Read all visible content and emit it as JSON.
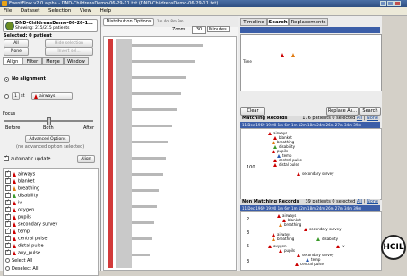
{
  "window": {
    "title": "EventFlow v2.0 alpha - DND-ChildrensDemo-06-29-11.txt (DND-ChildrensDemo-06-29-11.txt)"
  },
  "menu": [
    "File",
    "Dataset",
    "Selection",
    "View",
    "Help"
  ],
  "dataset": {
    "name": "DND-ChildrensDemo-06-26-1...",
    "showing": "Showing: 215/215 patients"
  },
  "selection": {
    "label": "Selected: 0 patient",
    "all": "All",
    "none": "None",
    "hide": "Hide selection",
    "invert": "Invert sel..."
  },
  "left_tabs": [
    "Align",
    "Filter",
    "Merge",
    "Window"
  ],
  "align": {
    "no_alignment": "No alignment",
    "nth_prefix": "1",
    "nth_of": "st",
    "event": "airways",
    "focus_label": "Focus",
    "ticks": [
      "Before",
      "Both",
      "After"
    ],
    "advanced": "Advanced Options",
    "no_advanced": "(no advanced option selected)",
    "auto_update": "automatic update",
    "align_button": "Align"
  },
  "legend": [
    {
      "label": "airways",
      "color": "#cc0000"
    },
    {
      "label": "blanket",
      "color": "#cc0000"
    },
    {
      "label": "breathing",
      "color": "#e07a10"
    },
    {
      "label": "disability",
      "color": "#3a9a2a"
    },
    {
      "label": "iv",
      "color": "#cc0000"
    },
    {
      "label": "oxygen",
      "color": "#cc0000"
    },
    {
      "label": "pupils",
      "color": "#cc0000"
    },
    {
      "label": "secondary survey",
      "color": "#cc0000"
    },
    {
      "label": "temp",
      "color": "#cc0000"
    },
    {
      "label": "central pulse",
      "color": "#cc0000"
    },
    {
      "label": "distal pulse",
      "color": "#cc0000"
    },
    {
      "label": "any_pulse",
      "color": "#cc0000"
    },
    {
      "label": "Select All",
      "color": ""
    },
    {
      "label": "Deselect All",
      "color": ""
    }
  ],
  "center": {
    "dist_button": "Distribution Options",
    "scale": "1m 4m 8m 9m",
    "zoom_label": "Zoom:",
    "zoom_value": "30",
    "zoom_unit": "Minutes"
  },
  "right_tabs": [
    "Timeline",
    "Search",
    "Replacements"
  ],
  "search": {
    "time_label": "Time",
    "clear": "Clear",
    "replace": "Replace As...",
    "search": "Search"
  },
  "matching": {
    "title": "Matching Records",
    "count": "176 patients 0 selected",
    "all_link": "All",
    "none_link": "None",
    "date": "11 Dec 1969 19:00   1m 6m 1m 12m 18m 24m 26m 27m 34m 39m",
    "group_count": "100",
    "events": [
      "airways",
      "blanket",
      "breathing",
      "disability",
      "pupils",
      "temp",
      "central pulse",
      "distal pulse",
      "secondary survey"
    ]
  },
  "nonmatching": {
    "title": "Non Matching Records",
    "count": "39 patients 0 selected",
    "all_link": "All",
    "none_link": "None",
    "date": "11 Dec 1969 19:00   1m 6m 1m 12m 18m 24m 26m 27m 34m 39m",
    "groups": [
      "2",
      "3",
      "5",
      "3"
    ],
    "events": [
      "airways",
      "blanket",
      "breathing",
      "secondary survey",
      "airways",
      "breathing",
      "disability",
      "oxygen",
      "pupils",
      "iv",
      "secondary survey",
      "temp",
      "central pulse"
    ]
  },
  "logo": "HCIL"
}
